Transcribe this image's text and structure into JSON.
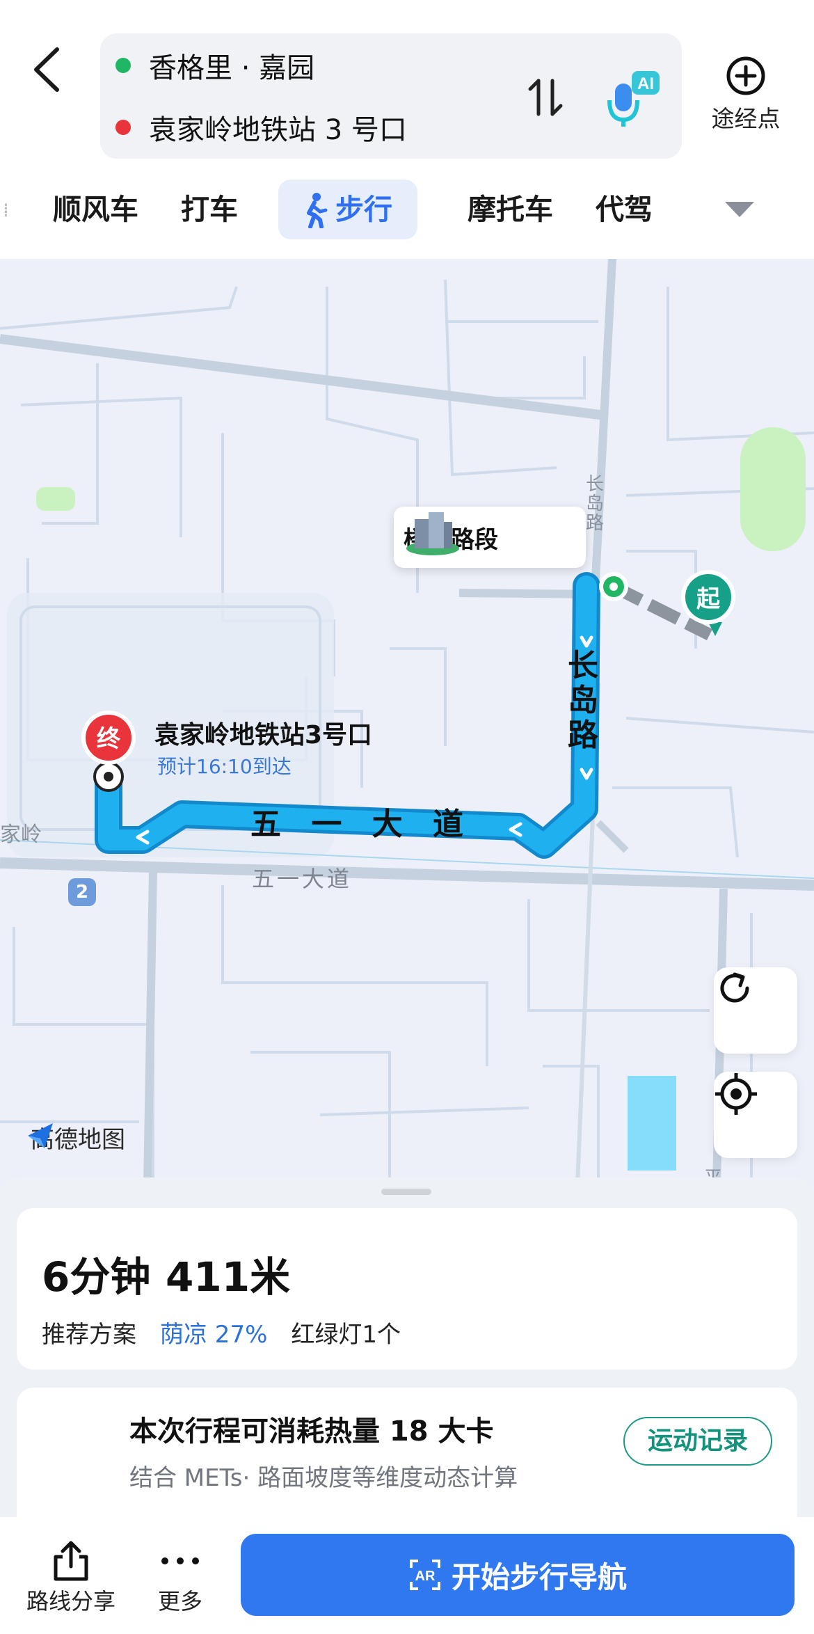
{
  "header": {
    "origin": "香格里 · 嘉园",
    "destination": "袁家岭地铁站 3 号口",
    "waypoint_label": "途经点",
    "ai_badge": "AI",
    "colors": {
      "origin_dot": "#1fb764",
      "destination_dot": "#e8343a"
    }
  },
  "mode_tabs": [
    {
      "label": "顺风车",
      "active": false
    },
    {
      "label": "打车",
      "active": false
    },
    {
      "label": "步行",
      "active": true
    },
    {
      "label": "摩托车",
      "active": false
    },
    {
      "label": "代驾",
      "active": false
    }
  ],
  "map": {
    "destination_name": "袁家岭地铁站3号口",
    "eta": "预计16:10到达",
    "start_marker": "起",
    "end_marker": "终",
    "callout": "楼阴路段",
    "road_main_bold": "五 一 大 道",
    "road_main": "五一大道",
    "road_vertical_bold": "长岛路",
    "road_vertical": "长岛路",
    "road_partial_left": "家岭",
    "road_partial_bottom": "平",
    "metro_badge": "2",
    "brand": "高德地图",
    "route_color": "#1fb0f0"
  },
  "summary": {
    "time": "6分钟",
    "distance": "411米",
    "recommend": "推荐方案",
    "shade": "荫凉 27%",
    "traffic_lights": "红绿灯1个"
  },
  "calories": {
    "title": "本次行程可消耗热量 18 大卡",
    "subtitle": "结合 METs· 路面坡度等维度动态计算",
    "button": "运动记录"
  },
  "bottom_bar": {
    "share": "路线分享",
    "more": "更多",
    "start_nav": "开始步行导航"
  }
}
